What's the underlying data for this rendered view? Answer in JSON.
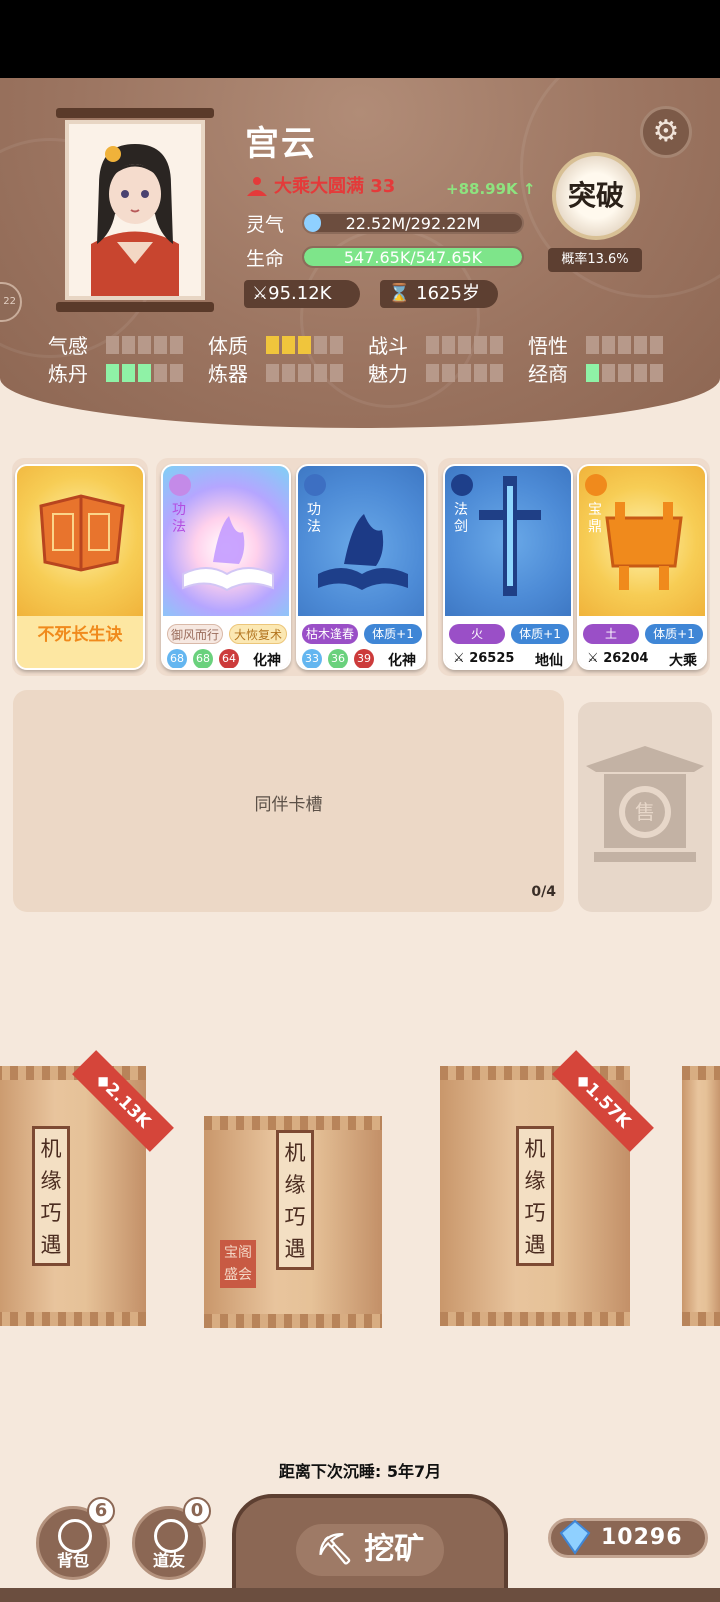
{
  "character": {
    "name": "宫云",
    "realm": "大乘大圆满 33",
    "rate": "+88.99K ↑",
    "qi_label": "灵气",
    "qi_value": "22.52M/292.22M",
    "qi_fraction": 0.077,
    "hp_label": "生命",
    "hp_value": "547.65K/547.65K",
    "hp_fraction": 1.0,
    "power": "95.12K",
    "age": "1625岁",
    "side_tab": "22"
  },
  "breakthrough": {
    "label": "突破",
    "probability": "概率13.6%"
  },
  "attributes": [
    {
      "label": "气感",
      "filled": 0,
      "color": "none"
    },
    {
      "label": "体质",
      "filled": 3,
      "color": "yellow"
    },
    {
      "label": "战斗",
      "filled": 0,
      "color": "none"
    },
    {
      "label": "悟性",
      "filled": 0,
      "color": "none"
    },
    {
      "label": "炼丹",
      "filled": 3,
      "color": "green"
    },
    {
      "label": "炼器",
      "filled": 0,
      "color": "none"
    },
    {
      "label": "魅力",
      "filled": 0,
      "color": "none"
    },
    {
      "label": "经商",
      "filled": 1,
      "color": "green"
    }
  ],
  "cards": {
    "main_method": {
      "name": "不死长生诀"
    },
    "method1": {
      "type": "功法",
      "chip1": "御风而行",
      "chip2": "大恢复术",
      "n1": "68",
      "n2": "68",
      "n3": "64",
      "level": "化神"
    },
    "method2": {
      "type": "功法",
      "chip1": "枯木逢春",
      "chip2": "体质+1",
      "n1": "33",
      "n2": "36",
      "n3": "39",
      "level": "化神"
    },
    "sword": {
      "type": "法剑",
      "element": "火",
      "bonus": "体质+1",
      "power": "26525",
      "level": "地仙"
    },
    "cauldron": {
      "type": "宝鼎",
      "element": "土",
      "bonus": "体质+1",
      "power": "26204",
      "level": "大乘"
    }
  },
  "companion": {
    "title": "同伴卡槽",
    "count": "0/4"
  },
  "shop": {
    "sign": "售"
  },
  "packs": [
    {
      "label": "机缘巧遇",
      "price": "2.13K"
    },
    {
      "label": "机缘巧遇",
      "stamp": "宝阁盛会"
    },
    {
      "label": "机缘巧遇",
      "price": "1.57K"
    }
  ],
  "sleep_text": "距离下次沉睡: 5年7月",
  "bottom": {
    "bag": {
      "label": "背包",
      "count": "6"
    },
    "friends": {
      "label": "道友",
      "count": "0"
    },
    "mine": "挖矿",
    "gems": "10296"
  },
  "colors": {
    "header": "#9c7561",
    "qi_bar": "#8fd0ff",
    "hp_bar": "#7ee58a",
    "realm": "#e43a3a"
  }
}
